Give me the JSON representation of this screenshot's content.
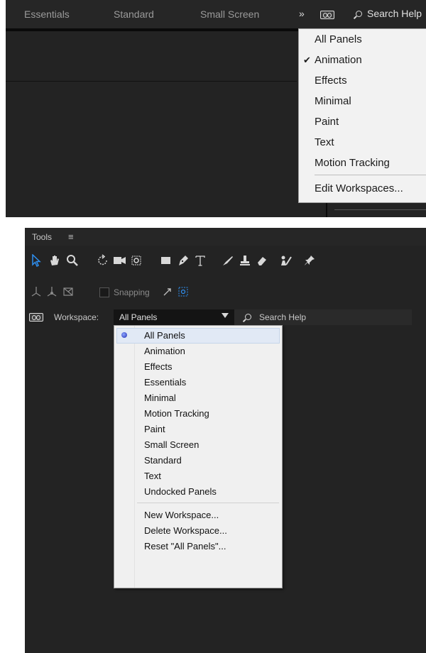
{
  "top_panel": {
    "workspace_tabs": [
      "Essentials",
      "Standard",
      "Small Screen"
    ],
    "overflow_chevron": "»",
    "search_label": "Search Help",
    "menu": {
      "items": [
        "All Panels",
        "Animation",
        "Effects",
        "Minimal",
        "Paint",
        "Text",
        "Motion Tracking"
      ],
      "checked_item": "Animation",
      "check_glyph": "✔",
      "footer_item": "Edit Workspaces..."
    }
  },
  "bottom_panel": {
    "tools_title": "Tools",
    "tools_menu_glyph": "≡",
    "snapping_label": "Snapping",
    "workspace_label": "Workspace:",
    "workspace_value": "All Panels",
    "search_label": "Search Help",
    "dropdown": {
      "items": [
        "All Panels",
        "Animation",
        "Effects",
        "Essentials",
        "Minimal",
        "Motion Tracking",
        "Paint",
        "Small Screen",
        "Standard",
        "Text",
        "Undocked Panels"
      ],
      "selected_item": "All Panels",
      "actions": [
        "New Workspace...",
        "Delete Workspace...",
        "Reset \"All Panels\"..."
      ]
    }
  },
  "colors": {
    "panel_bg": "#232323",
    "accent_blue": "#2f8ff0",
    "menu_bg": "#f0f0f0"
  }
}
